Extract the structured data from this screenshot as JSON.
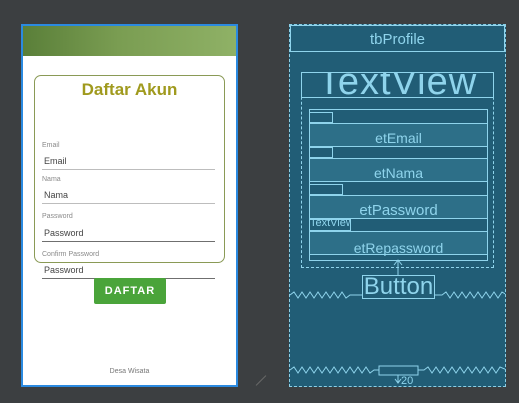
{
  "design": {
    "title": "Daftar Akun",
    "fields": [
      {
        "label": "Email",
        "value": "Email"
      },
      {
        "label": "Nama",
        "value": "Nama"
      },
      {
        "label": "Password",
        "value": "Password"
      },
      {
        "label": "Confirm Password",
        "value": "Password"
      }
    ],
    "button": "DAFTAR",
    "footer": "Desa Wisata"
  },
  "blueprint": {
    "toolbar_label": "tbProfile",
    "title_label": "TextView",
    "field_labels": [
      "etEmail",
      "etNama",
      "etPassword",
      "etRepassword"
    ],
    "small_textview": "TextView",
    "button_label": "Button",
    "bottom_margin": "20"
  },
  "colors": {
    "accent_green": "#4aa43a",
    "title_olive": "#a09a1e",
    "blueprint_bg": "#215d76",
    "blueprint_line": "#8fd4ec",
    "selection_blue": "#2b8ae0"
  }
}
